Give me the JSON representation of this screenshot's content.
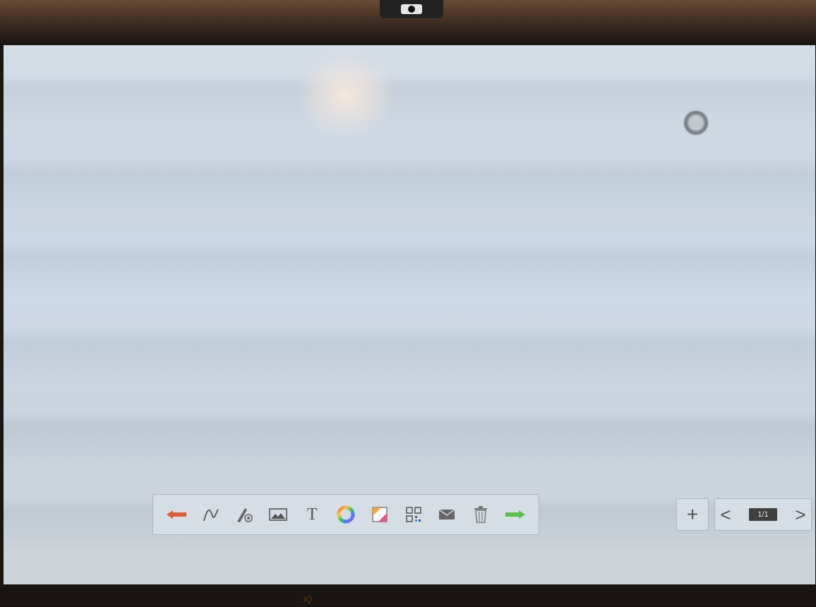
{
  "toolbar": {
    "tools": [
      {
        "name": "undo-arrow-icon",
        "color": "#e05a3a"
      },
      {
        "name": "pen-icon"
      },
      {
        "name": "eraser-icon"
      },
      {
        "name": "image-icon"
      },
      {
        "name": "text-tool",
        "label": "T"
      },
      {
        "name": "color-wheel-icon"
      },
      {
        "name": "background-icon"
      },
      {
        "name": "qr-code-icon"
      },
      {
        "name": "email-icon"
      },
      {
        "name": "trash-icon"
      },
      {
        "name": "redo-arrow-icon",
        "color": "#5fbf4a"
      }
    ]
  },
  "pager": {
    "add_label": "+",
    "prev_label": "<",
    "next_label": ">",
    "page_indicator": "1/1"
  },
  "bezel": {
    "logo_text": "iQ"
  }
}
